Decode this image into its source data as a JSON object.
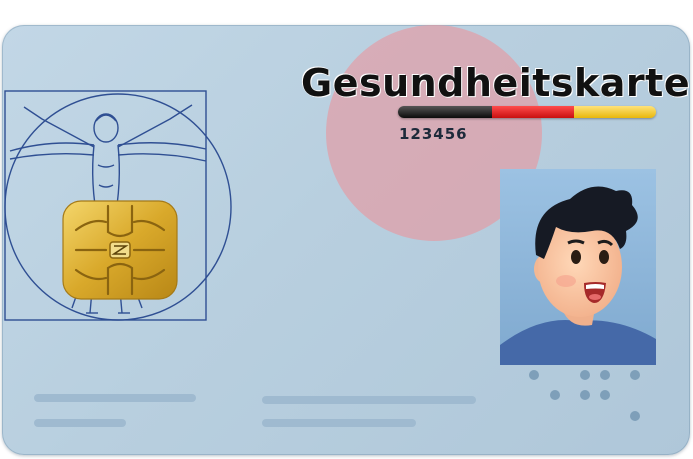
{
  "card": {
    "title": "Gesundheitskarte",
    "number": "123456",
    "flag_colors": [
      "#000000",
      "#dd0000",
      "#ffce00"
    ]
  },
  "icons": {
    "chip": "smart-card-chip-icon",
    "emblem": "vitruvian-man-icon",
    "photo": "user-avatar-icon"
  },
  "colors": {
    "card_background": "#bdd3e3",
    "circle_accent": "#e8969e",
    "chip_gold": "#e0b53a"
  }
}
